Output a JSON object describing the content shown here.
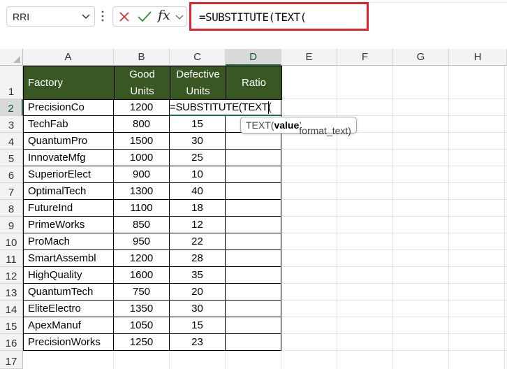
{
  "name_box": {
    "value": "RRI"
  },
  "formula_bar": {
    "fx_label": "fx",
    "formula": "=SUBSTITUTE(TEXT(",
    "highlight_color": "#e02430"
  },
  "column_headers": [
    "A",
    "B",
    "C",
    "D",
    "E",
    "F",
    "G",
    "H"
  ],
  "selected_column": "D",
  "selected_row": "2",
  "row_headers": [
    "1",
    "2",
    "3",
    "4",
    "5",
    "6",
    "7",
    "8",
    "9",
    "10",
    "11",
    "12",
    "13",
    "14",
    "15",
    "16",
    "17"
  ],
  "table": {
    "header_bg": "#385723",
    "headers": {
      "factory": "Factory",
      "good_line1": "Good",
      "good_line2": "Units",
      "defective_line1": "Defective",
      "defective_line2": "Units",
      "ratio": "Ratio"
    },
    "rows": [
      {
        "factory": "PrecisionCo",
        "good": "1200",
        "defective": "=SUBSTITUTE(TEXT("
      },
      {
        "factory": "TechFab",
        "good": "800",
        "defective": "15"
      },
      {
        "factory": "QuantumPro",
        "good": "1500",
        "defective": "30"
      },
      {
        "factory": "InnovateMfg",
        "good": "1000",
        "defective": "25"
      },
      {
        "factory": "SuperiorElect",
        "good": "900",
        "defective": "10"
      },
      {
        "factory": "OptimalTech",
        "good": "1300",
        "defective": "40"
      },
      {
        "factory": "FutureInd",
        "good": "1100",
        "defective": "18"
      },
      {
        "factory": "PrimeWorks",
        "good": "850",
        "defective": "12"
      },
      {
        "factory": "ProMach",
        "good": "950",
        "defective": "22"
      },
      {
        "factory": "SmartAssembl",
        "good": "1200",
        "defective": "28"
      },
      {
        "factory": "HighQuality",
        "good": "1600",
        "defective": "35"
      },
      {
        "factory": "QuantumTech",
        "good": "750",
        "defective": "20"
      },
      {
        "factory": "EliteElectro",
        "good": "1350",
        "defective": "30"
      },
      {
        "factory": "ApexManuf",
        "good": "1050",
        "defective": "15"
      },
      {
        "factory": "PrecisionWorks",
        "good": "1250",
        "defective": "23"
      }
    ]
  },
  "tooltip": {
    "func": "TEXT(",
    "arg_bold": "value",
    "rest": ", format_text)"
  },
  "accent_color": "#1e7145",
  "icons": [
    "chevron-down-icon",
    "more-options-icon",
    "cancel-icon",
    "enter-icon",
    "insert-function-icon"
  ]
}
